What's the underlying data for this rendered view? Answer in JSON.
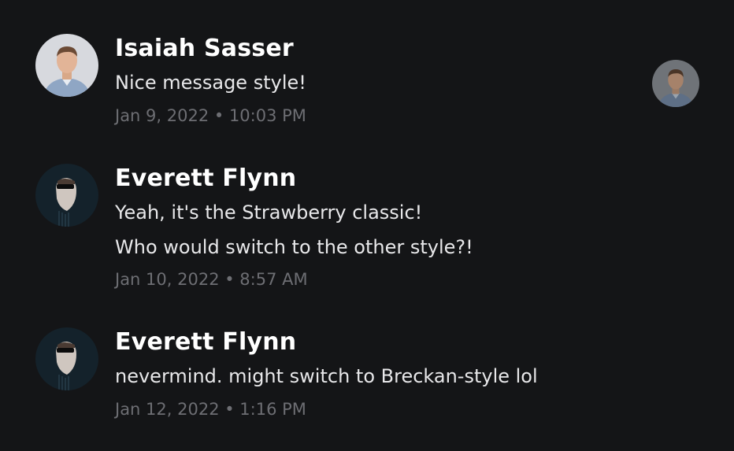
{
  "messages": [
    {
      "author": "Isaiah Sasser",
      "avatar": "isaiah-avatar",
      "lines": [
        "Nice message style!"
      ],
      "timestamp": "Jan 9, 2022 • 10:03 PM"
    },
    {
      "author": "Everett Flynn",
      "avatar": "everett-avatar",
      "lines": [
        "Yeah, it's the Strawberry classic!",
        "Who would switch to the other style?!"
      ],
      "timestamp": "Jan 10, 2022 • 8:57 AM"
    },
    {
      "author": "Everett Flynn",
      "avatar": "everett-avatar",
      "lines": [
        "nevermind. might switch to Breckan-style lol"
      ],
      "timestamp": "Jan 12, 2022 • 1:16 PM"
    }
  ],
  "read_receipt": {
    "avatar": "isaiah-avatar"
  },
  "colors": {
    "background": "#141517",
    "name": "#ffffff",
    "body_text": "#e8e8ea",
    "timestamp": "#6d6e73"
  }
}
